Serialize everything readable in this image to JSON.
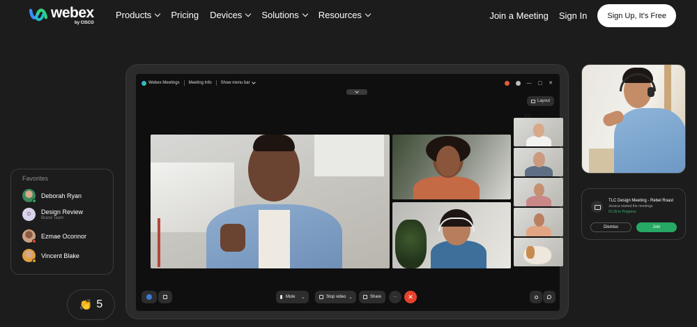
{
  "brand": {
    "name": "webex",
    "by": "by CISCO"
  },
  "nav": {
    "menu": [
      {
        "label": "Products",
        "dropdown": true
      },
      {
        "label": "Pricing",
        "dropdown": false
      },
      {
        "label": "Devices",
        "dropdown": true
      },
      {
        "label": "Solutions",
        "dropdown": true
      },
      {
        "label": "Resources",
        "dropdown": true
      }
    ],
    "join_meeting": "Join a Meeting",
    "sign_in": "Sign In",
    "signup": "Sign Up, It's Free"
  },
  "meeting_window": {
    "app_title": "Webex Meetings",
    "meeting_info": "Meeting Info",
    "show_menu_bar": "Show menu bar",
    "layout": "Layout",
    "controls": {
      "mute": "Mute",
      "stop_video": "Stop video",
      "share": "Share",
      "more": "···"
    }
  },
  "favorites": {
    "title": "Favorites",
    "items": [
      {
        "name": "Deborah Ryan",
        "sub": ""
      },
      {
        "name": "Design Review",
        "sub": "Brand Team",
        "initial": "D"
      },
      {
        "name": "Ezmae Oconnor",
        "sub": ""
      },
      {
        "name": "Vincent Blake",
        "sub": ""
      }
    ]
  },
  "reactions": {
    "emoji": "👏",
    "count": "5"
  },
  "notification": {
    "title": "TLC Design Meeting - Rebel Roast",
    "subtitle": "Jessica started the meetings",
    "time": "01:26  In Progress",
    "dismiss": "Dismiss",
    "join": "Join"
  },
  "colors": {
    "accent_green": "#27a864",
    "end_call_red": "#e5422b"
  }
}
